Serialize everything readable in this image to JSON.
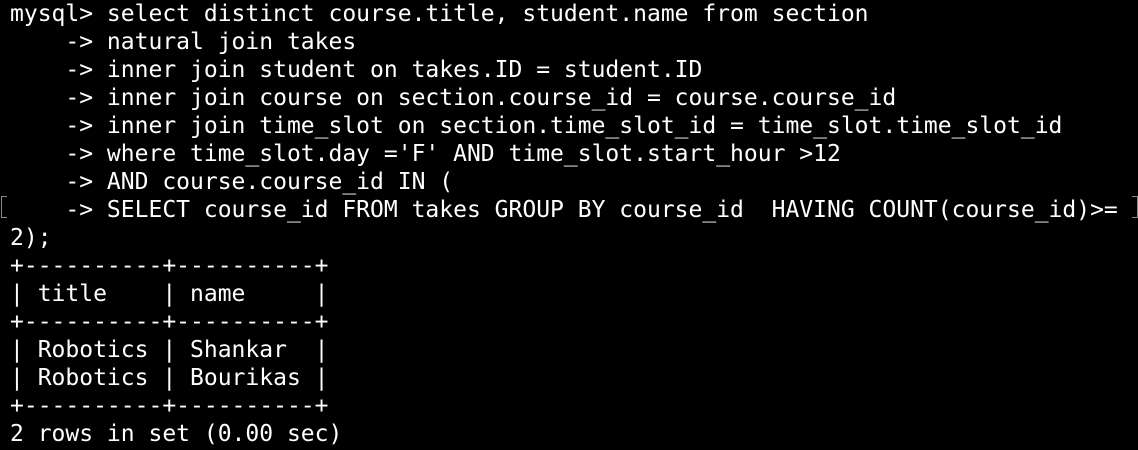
{
  "terminal": {
    "background": "#000000",
    "foreground": "#ffffff",
    "lines": [
      "mysql> select distinct course.title, student.name from section",
      "    -> natural join takes",
      "    -> inner join student on takes.ID = student.ID",
      "    -> inner join course on section.course_id = course.course_id",
      "    -> inner join time_slot on section.time_slot_id = time_slot.time_slot_id",
      "    -> where time_slot.day ='F' AND time_slot.start_hour >12",
      "    -> AND course.course_id IN (",
      "    -> SELECT course_id FROM takes GROUP BY course_id  HAVING COUNT(course_id)>=",
      "2);",
      "+----------+----------+",
      "| title    | name     |",
      "+----------+----------+",
      "| Robotics | Shankar  |",
      "| Robotics | Bourikas |",
      "+----------+----------+",
      "2 rows in set (0.00 sec)"
    ]
  }
}
